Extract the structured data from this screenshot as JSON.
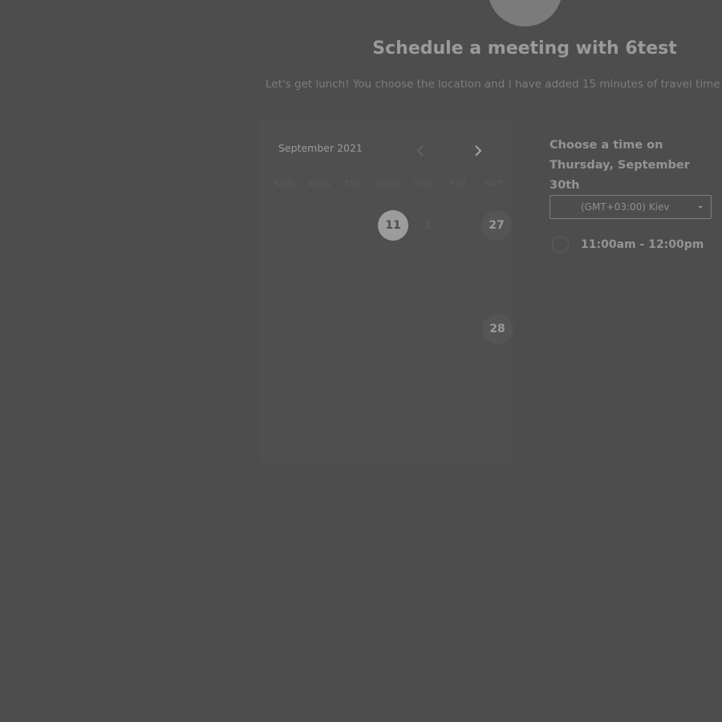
{
  "header": {
    "title": "Schedule a meeting with 6test",
    "subtitle": "Let's get lunch! You choose the location and I have added 15 minutes of travel time"
  },
  "calendar": {
    "month_label": "September 2021",
    "prev_icon": "chevron-left-icon",
    "next_icon": "chevron-right-icon",
    "weekdays": [
      "SUN",
      "MON",
      "TUE",
      "WED",
      "THU",
      "FRI",
      "SAT"
    ],
    "visible_days": {
      "selected": "11",
      "faint": "1",
      "available_1": "27",
      "available_2": "28"
    }
  },
  "times": {
    "heading": "Choose a time on Thursday, September 30th",
    "timezone": "(GMT+03:00) Kiev",
    "slots": [
      "11:00am - 12:00pm"
    ]
  },
  "colors": {
    "overlay_bg": "#4d4d4d",
    "selected_day_bg": "#9c9c9c"
  }
}
